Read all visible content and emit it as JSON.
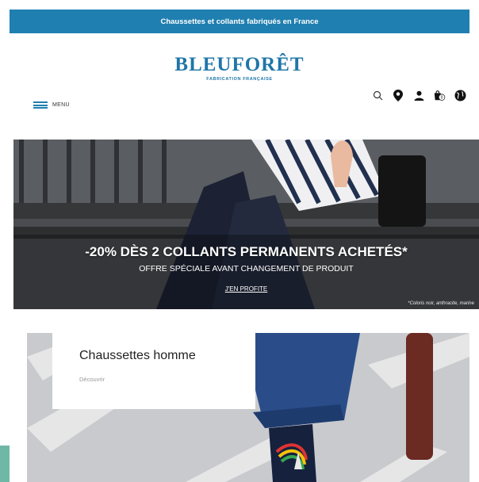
{
  "announcement": "Chaussettes et collants fabriqués en France",
  "logo": {
    "brand": "BLEUFORÊT",
    "tagline": "FABRICATION FRANÇAISE"
  },
  "menu": {
    "label": "MENU"
  },
  "header_icons": [
    "search-icon",
    "location-pin-icon",
    "account-icon",
    "cart-icon",
    "globe-icon"
  ],
  "cart": {
    "count": "0"
  },
  "banner": {
    "headline": "-20% DÈS 2 COLLANTS PERMANENTS ACHETÉS*",
    "subline": "OFFRE SPÉCIALE AVANT CHANGEMENT DE PRODUIT",
    "cta": "J'EN PROFITE",
    "note": "*Coloris noir, anthracite, marine"
  },
  "promo": {
    "title": "Chaussettes homme",
    "link": "Découvrir"
  },
  "colors": {
    "brand_blue": "#1f7fb0",
    "chat_tab": "#6fb8a5"
  }
}
